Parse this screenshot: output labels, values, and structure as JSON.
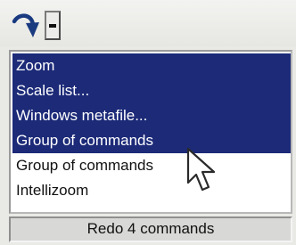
{
  "toolbar": {
    "redo_icon": "redo-arrow-icon",
    "dropdown_icon": "dropdown-arrow-icon"
  },
  "redo_list": {
    "items": [
      {
        "label": "Zoom",
        "selected": true
      },
      {
        "label": "Scale list...",
        "selected": true
      },
      {
        "label": "Windows metafile...",
        "selected": true
      },
      {
        "label": "Group of commands",
        "selected": true
      },
      {
        "label": "Group of commands",
        "selected": false
      },
      {
        "label": "Intellizoom",
        "selected": false
      }
    ],
    "selection_color": "#1c2a78"
  },
  "status": {
    "text": "Redo 4 commands"
  },
  "colors": {
    "redo_arrow": "#1a3a80",
    "selection_bg": "#1c2a78"
  }
}
